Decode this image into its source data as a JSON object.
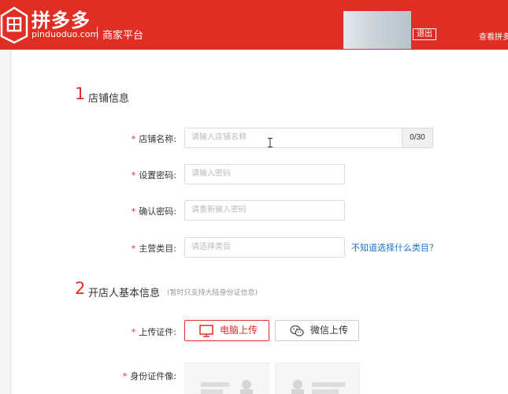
{
  "header": {
    "logo_cn": "拼多多",
    "logo_en": "pinduoduo.com",
    "platform": "商家平台",
    "logout": "退出",
    "view_link": "查看拼多"
  },
  "section1": {
    "number": "1",
    "title": "店铺信息",
    "fields": [
      {
        "label": "店铺名称:",
        "placeholder": "请输入店铺名称",
        "counter": "0/30"
      },
      {
        "label": "设置密码:",
        "placeholder": "请输入密码"
      },
      {
        "label": "确认密码:",
        "placeholder": "请重新输入密码"
      },
      {
        "label": "主营类目:",
        "placeholder": "请选择类目",
        "help": "不知道选择什么类目？"
      }
    ]
  },
  "section2": {
    "number": "2",
    "title": "开店人基本信息",
    "note": "(暂时只支持大陆身份证信息)",
    "upload_label": "上传证件:",
    "upload_pc": "电脑上传",
    "upload_wechat": "微信上传",
    "id_label": "身份证件像:"
  },
  "required_mark": "*",
  "colors": {
    "brand": "#e02e24",
    "link": "#1a73c8"
  }
}
